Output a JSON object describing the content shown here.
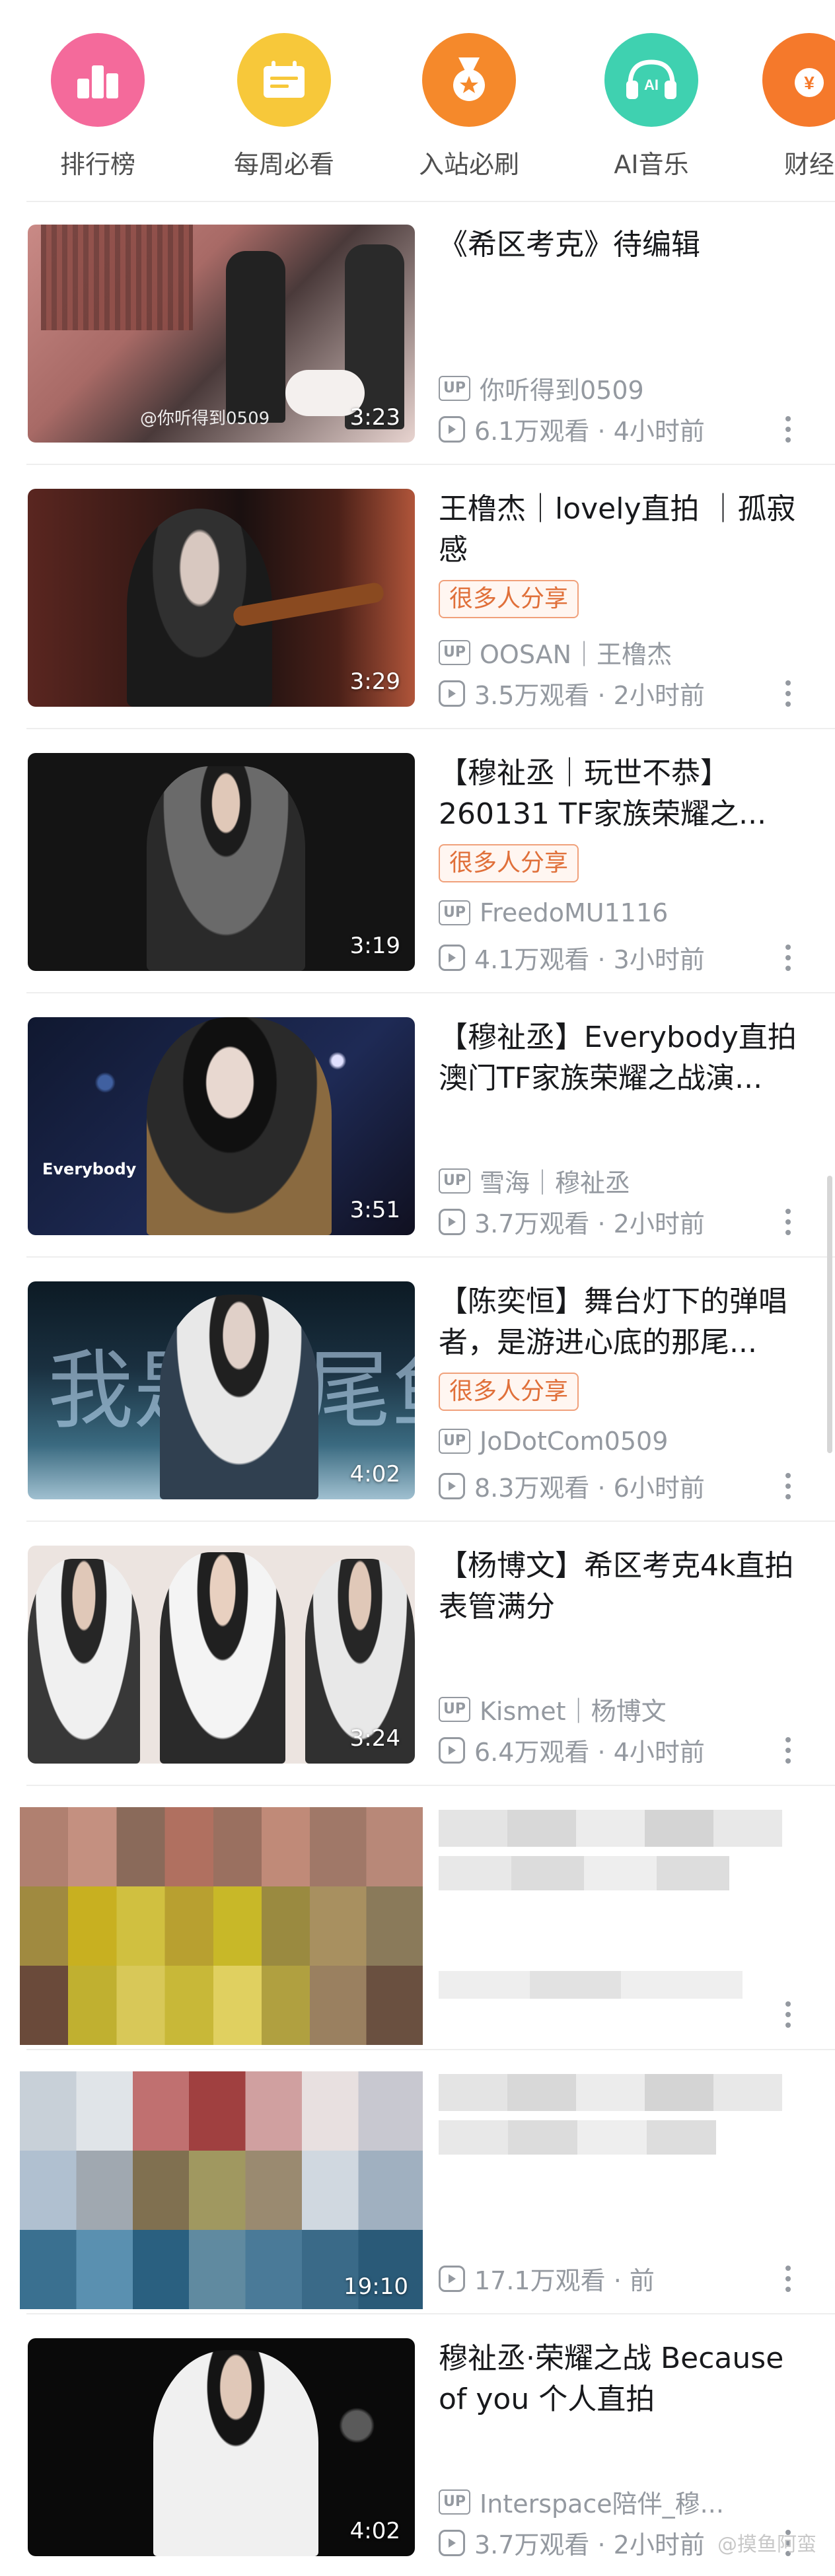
{
  "categories": [
    {
      "label": "排行榜",
      "icon": "ranking-icon",
      "color": "#f46a9b"
    },
    {
      "label": "每周必看",
      "icon": "calendar-icon",
      "color": "#f7c83a"
    },
    {
      "label": "入站必刷",
      "icon": "medal-icon",
      "color": "#f5892b"
    },
    {
      "label": "AI音乐",
      "icon": "ai-music-icon",
      "color": "#3fd1b0",
      "badge": "AI"
    },
    {
      "label": "财经",
      "icon": "finance-icon",
      "color": "#f5792b"
    }
  ],
  "videos": [
    {
      "title": "《希区考克》待编辑",
      "tag": "",
      "uploader": "你听得到0509",
      "views": "6.1万观看 · 4小时前",
      "duration": "3:23",
      "watermark": "@你听得到0509",
      "thumb_colors": [
        "#c98a86",
        "#4a3a3a",
        "#e8d4d0"
      ]
    },
    {
      "title": "王橹杰｜lovely直拍 ｜孤寂感",
      "tag": "很多人分享",
      "uploader": "OOSAN｜王橹杰",
      "views": "3.5万观看 · 2小时前",
      "duration": "3:29",
      "watermark": "",
      "thumb_colors": [
        "#5a2620",
        "#1a1010",
        "#b0553a"
      ]
    },
    {
      "title": "【穆祉丞｜玩世不恭】260131 TF家族荣耀之...",
      "tag": "很多人分享",
      "uploader": "FreedoMU1116",
      "views": "4.1万观看 · 3小时前",
      "duration": "3:19",
      "watermark": "",
      "thumb_colors": [
        "#151515",
        "#2a2a2a",
        "#6a6a6a"
      ]
    },
    {
      "title": "【穆祉丞】Everybody直拍 澳门TF家族荣耀之战演...",
      "tag": "",
      "uploader": "雪海｜穆祉丞",
      "views": "3.7万观看 · 2小时前",
      "duration": "3:51",
      "watermark": "Everybody",
      "thumb_colors": [
        "#101830",
        "#1e2a55",
        "#8a6a40"
      ]
    },
    {
      "title": "【陈奕恒】舞台灯下的弹唱者，是游进心底的那尾...",
      "tag": "很多人分享",
      "uploader": "JoDotCom0509",
      "views": "8.3万观看 · 6小时前",
      "duration": "4:02",
      "watermark": "我是一尾鱼",
      "thumb_colors": [
        "#1a3040",
        "#3a6a80",
        "#a0c0d0"
      ]
    },
    {
      "title": "【杨博文】希区考克4k直拍 表管满分",
      "tag": "",
      "uploader": "Kismet｜杨博文",
      "views": "6.4万观看 · 4小时前",
      "duration": "3:24",
      "watermark": "",
      "thumb_colors": [
        "#e8e0dc",
        "#404040",
        "#c8b8b0"
      ]
    },
    {
      "title": "",
      "tag": "",
      "uploader": "",
      "views": "",
      "duration": "",
      "watermark": "",
      "thumb_colors": [
        "#b08070",
        "#c8b020",
        "#6a4a3a"
      ]
    },
    {
      "title": "",
      "tag": "",
      "uploader": "",
      "views": "17.1万观看 · 前",
      "duration": "19:10",
      "watermark": "",
      "thumb_colors": [
        "#c8d0d8",
        "#a04040",
        "#3a7090"
      ]
    },
    {
      "title": "穆祉丞·荣耀之战 Because of you 个人直拍",
      "tag": "",
      "uploader": "Interspace陪伴_穆...",
      "views": "3.7万观看 · 2小时前",
      "duration": "4:02",
      "watermark": "",
      "thumb_colors": [
        "#0a0a0a",
        "#e8e8e8",
        "#303030"
      ]
    }
  ],
  "corner_watermark": "@摸鱼阿蛮"
}
